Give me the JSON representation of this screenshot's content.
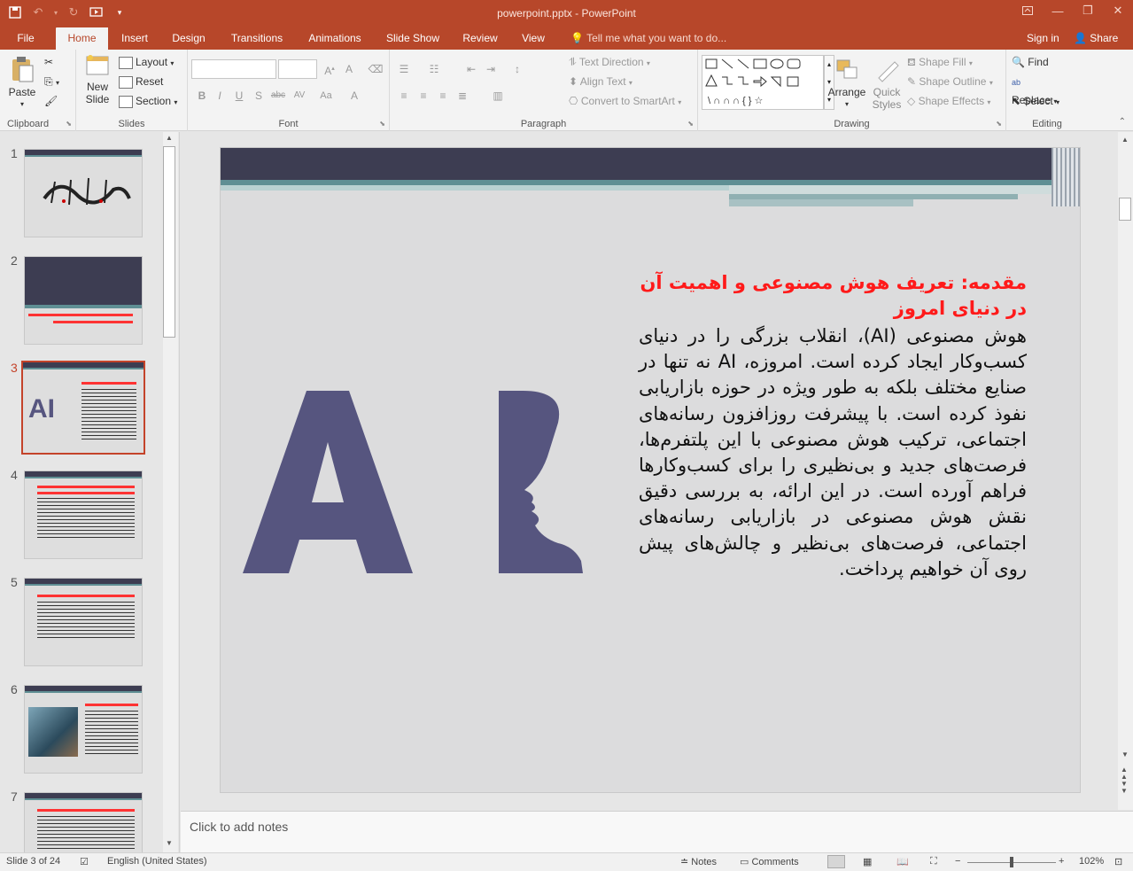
{
  "window": {
    "title": "powerpoint.pptx - PowerPoint"
  },
  "tabs": [
    "File",
    "Home",
    "Insert",
    "Design",
    "Transitions",
    "Animations",
    "Slide Show",
    "Review",
    "View"
  ],
  "tellme": "Tell me what you want to do...",
  "account": {
    "signin": "Sign in",
    "share": "Share"
  },
  "ribbon": {
    "clipboard": {
      "paste": "Paste",
      "label": "Clipboard"
    },
    "slides": {
      "new_slide": "New",
      "new_slide2": "Slide",
      "layout": "Layout",
      "reset": "Reset",
      "section": "Section",
      "label": "Slides"
    },
    "font": {
      "label": "Font"
    },
    "paragraph": {
      "text_direction": "Text Direction",
      "align_text": "Align Text",
      "convert_smartart": "Convert to SmartArt",
      "label": "Paragraph"
    },
    "drawing": {
      "arrange": "Arrange",
      "quick_styles": "Quick",
      "quick_styles2": "Styles",
      "shape_fill": "Shape Fill",
      "shape_outline": "Shape Outline",
      "shape_effects": "Shape Effects",
      "label": "Drawing"
    },
    "editing": {
      "find": "Find",
      "replace": "Replace",
      "select": "Select",
      "label": "Editing"
    }
  },
  "thumbnails": {
    "numbers": [
      "1",
      "2",
      "3",
      "4",
      "5",
      "6",
      "7"
    ]
  },
  "slide": {
    "title": "مقدمه: تعریف هوش مصنوعی و اهمیت آن در دنیای امروز",
    "body": "هوش مصنوعی (AI)، انقلاب بزرگی را در دنیای کسب‌وکار ایجاد کرده است. امروزه، AI نه تنها در صنایع مختلف بلکه به طور ویژه در حوزه بازاریابی نفوذ کرده است. با پیشرفت روزافزون رسانه‌های اجتماعی، ترکیب هوش مصنوعی با این پلتفرم‌ها، فرصت‌های جدید و بی‌نظیری را برای کسب‌وکارها فراهم آورده است. در این ارائه، به بررسی دقیق نقش هوش مصنوعی در بازاریابی رسانه‌های اجتماعی، فرصت‌های بی‌نظیر و چالش‌های پیش روی آن خواهیم پرداخت.",
    "logo_text": "AI"
  },
  "notes": {
    "placeholder": "Click to add notes"
  },
  "status": {
    "slide_info": "Slide 3 of 24",
    "language": "English (United States)",
    "notes": "Notes",
    "comments": "Comments",
    "zoom": "102%"
  },
  "colors": {
    "accent": "#b7472a",
    "slide_header": "#3d3d52",
    "title_red": "#ff1a1a",
    "logo": "#56557f"
  }
}
